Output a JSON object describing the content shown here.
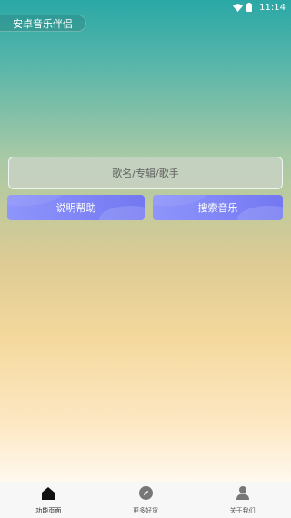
{
  "status_bar": {
    "time": "11:14",
    "icons": [
      "wifi-icon",
      "battery-icon"
    ]
  },
  "app": {
    "title": "安卓音乐伴侣"
  },
  "search": {
    "placeholder": "歌名/专辑/歌手",
    "value": ""
  },
  "actions": {
    "help_label": "说明帮助",
    "search_label": "搜索音乐"
  },
  "bottom_nav": {
    "items": [
      {
        "label": "功能页面",
        "icon": "home-icon",
        "active": true
      },
      {
        "label": "更多好货",
        "icon": "compass-icon",
        "active": false
      },
      {
        "label": "关于我们",
        "icon": "user-icon",
        "active": false
      }
    ]
  },
  "colors": {
    "gradient_top": "#2aa8a6",
    "gradient_mid": "#f4d89c",
    "button_purple": "#7f86f7",
    "nav_bg": "#f7f7f7"
  }
}
